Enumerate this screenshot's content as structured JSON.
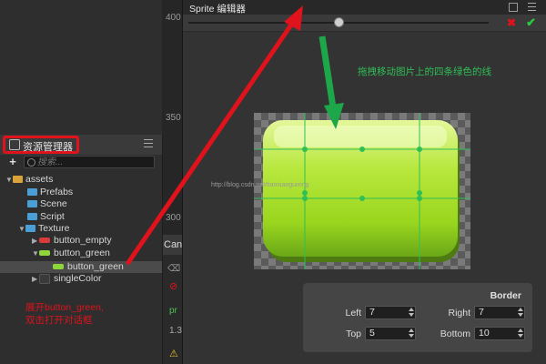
{
  "ruler": {
    "labels": [
      "400",
      "350",
      "300"
    ]
  },
  "assets_panel": {
    "title": "资源管理器",
    "search": {
      "placeholder": "搜索..."
    },
    "add_label": "+",
    "tree": [
      {
        "label": "assets",
        "icon": "folder-yellow-icon",
        "arrow": "▼"
      },
      {
        "label": "Prefabs",
        "icon": "folder-icon",
        "arrow": ""
      },
      {
        "label": "Scene",
        "icon": "folder-icon",
        "arrow": ""
      },
      {
        "label": "Script",
        "icon": "folder-icon",
        "arrow": ""
      },
      {
        "label": "Texture",
        "icon": "folder-icon",
        "arrow": "▼"
      },
      {
        "label": "button_empty",
        "icon": "texture-red-icon",
        "arrow": "▶"
      },
      {
        "label": "button_green",
        "icon": "texture-green-icon",
        "arrow": "▼"
      },
      {
        "label": "button_green",
        "icon": "sprite-frame-icon",
        "arrow": "",
        "selected": true
      },
      {
        "label": "singleColor",
        "icon": "texture-dark-icon",
        "arrow": "▶"
      }
    ]
  },
  "console": {
    "tab_label": "Can"
  },
  "annotations": {
    "left_red": [
      "展开button_green,",
      "双击打开对话框"
    ],
    "green_hint": "拖拽移动图片上的四条绿色的线",
    "watermark": "http://blog.csdn.net/tianxiaoguixing"
  },
  "sprite_editor": {
    "title": "Sprite 编辑器",
    "zoom_level": 0.5,
    "revert_label": "✖",
    "apply_label": "✔",
    "border": {
      "title": "Border",
      "left_label": "Left",
      "left_value": "7",
      "right_label": "Right",
      "right_value": "7",
      "top_label": "Top",
      "top_value": "5",
      "bottom_label": "Bottom",
      "bottom_value": "10"
    }
  },
  "colors": {
    "highlight_red": "#e0121b",
    "guide_green": "#2fbf55",
    "button_green": "#a8e030"
  }
}
